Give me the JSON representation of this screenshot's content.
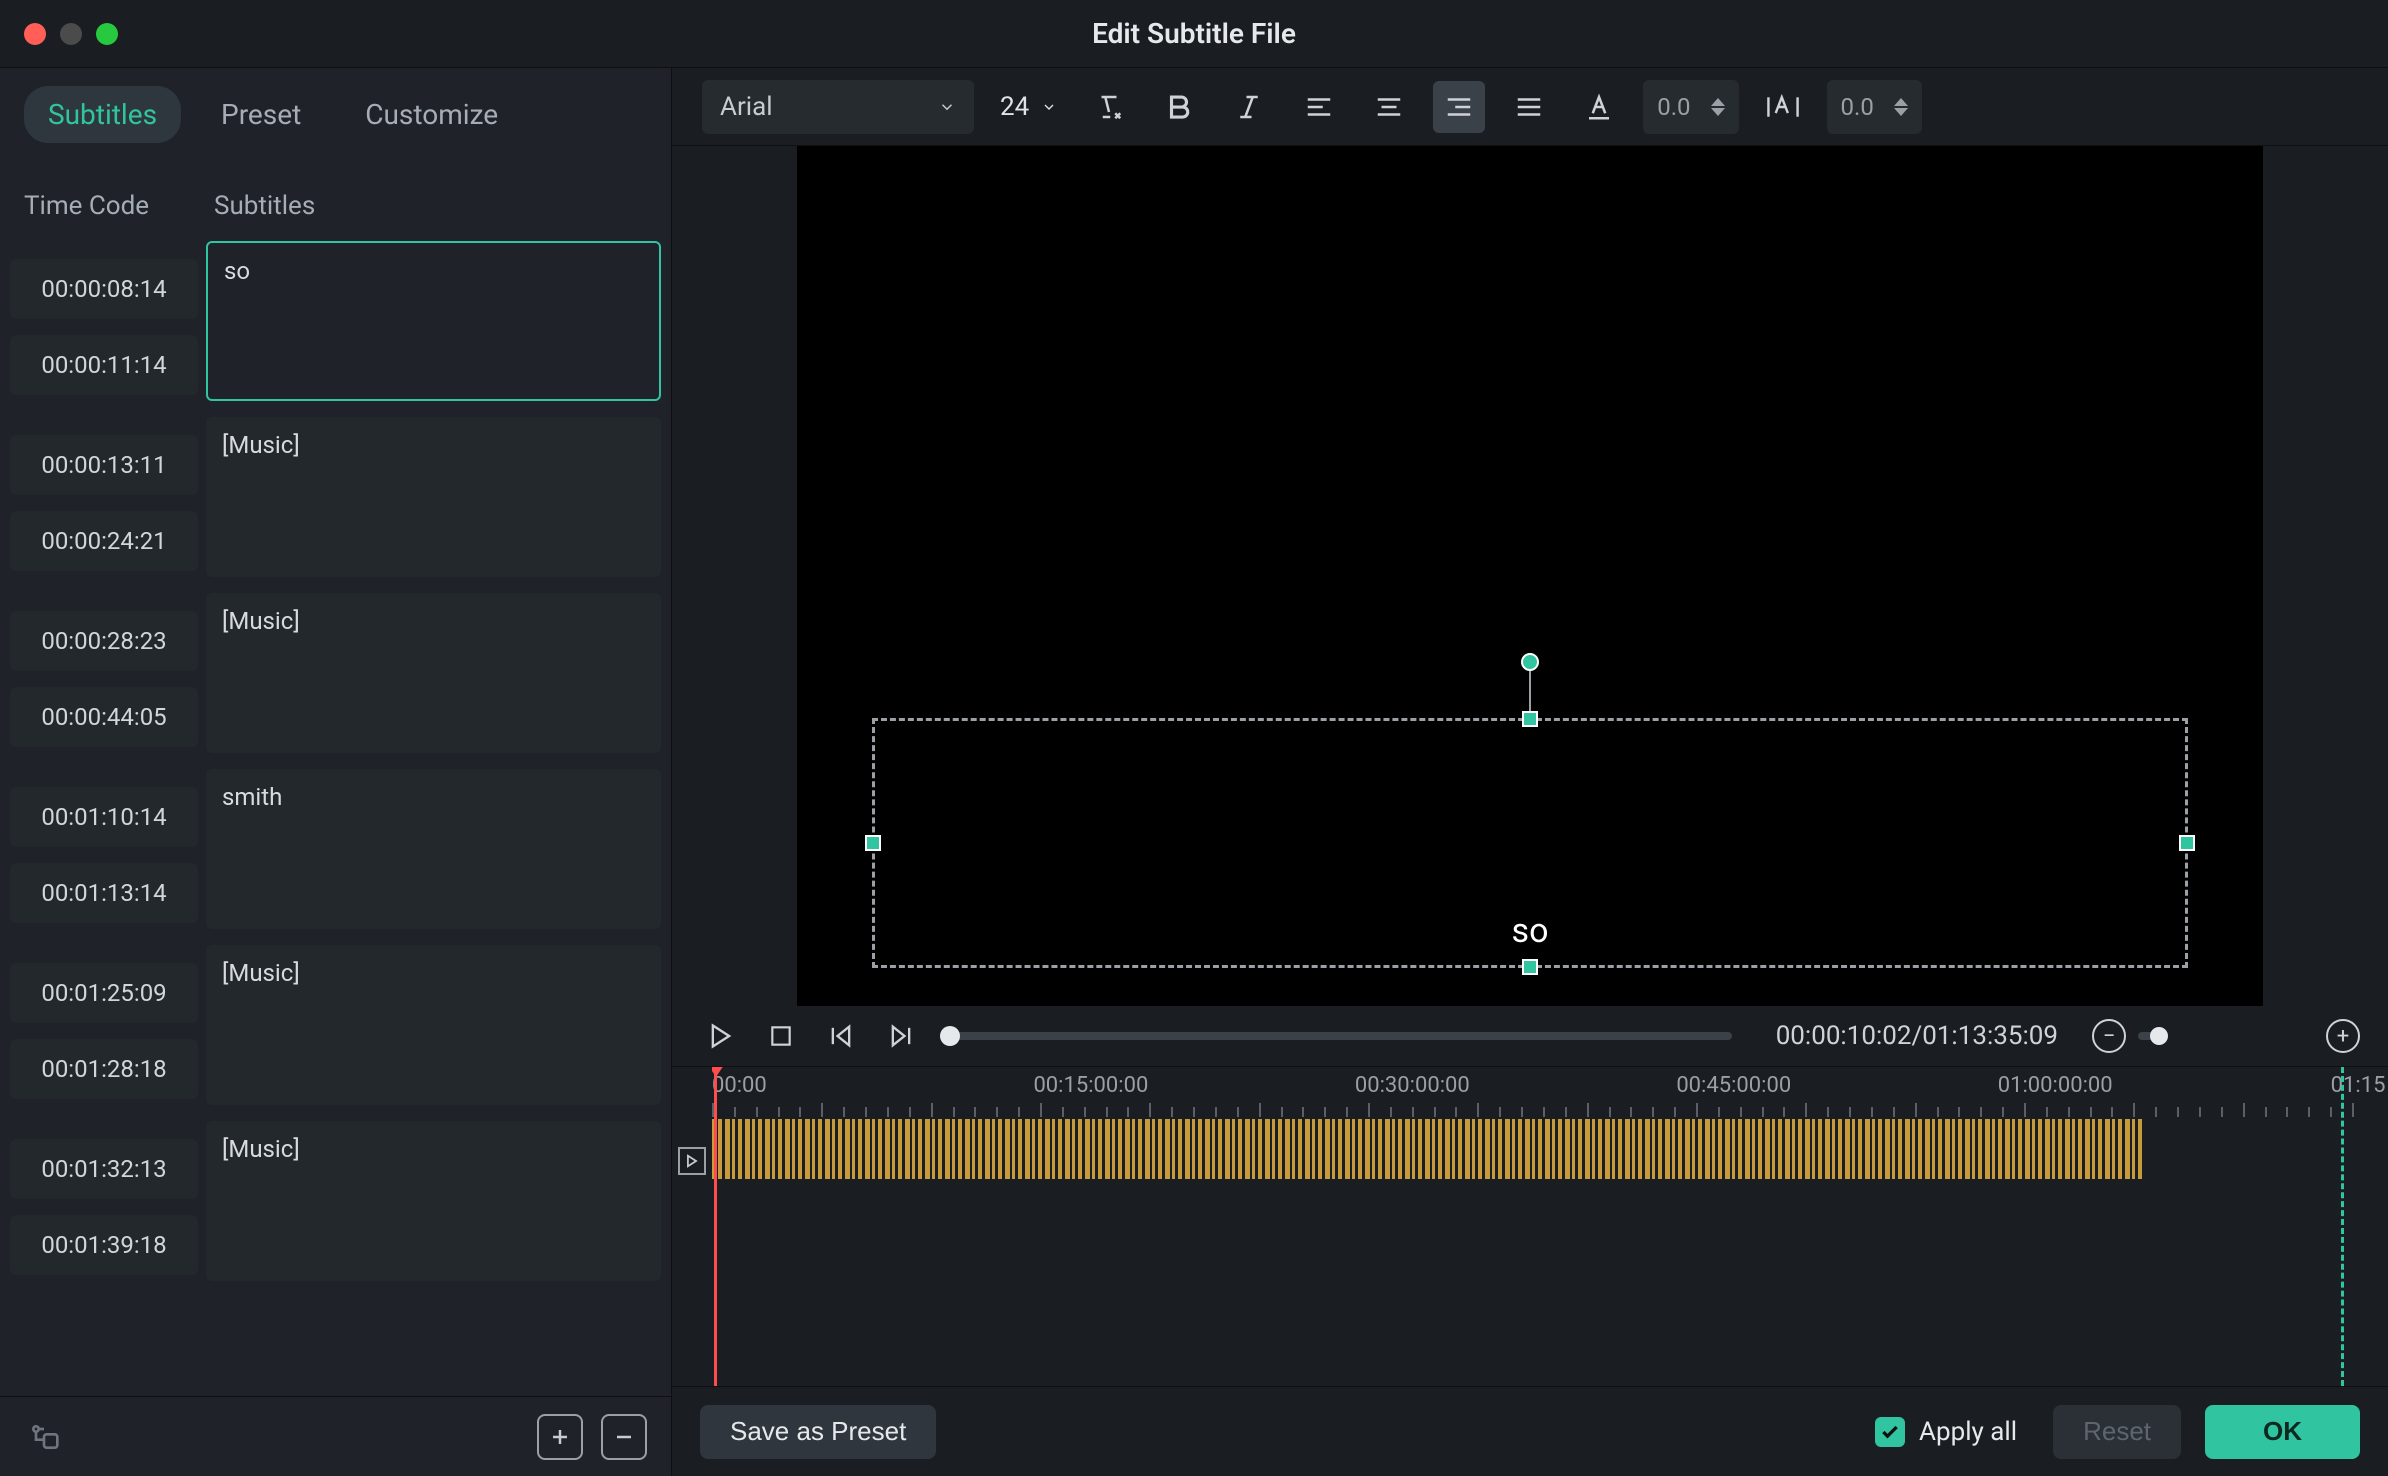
{
  "window": {
    "title": "Edit Subtitle File"
  },
  "tabs": {
    "subtitles": "Subtitles",
    "preset": "Preset",
    "customize": "Customize"
  },
  "headers": {
    "timecode": "Time Code",
    "subtitles": "Subtitles"
  },
  "rows": [
    {
      "start": "00:00:08:14",
      "end": "00:00:11:14",
      "text": "so",
      "active": true
    },
    {
      "start": "00:00:13:11",
      "end": "00:00:24:21",
      "text": "[Music]",
      "active": false
    },
    {
      "start": "00:00:28:23",
      "end": "00:00:44:05",
      "text": "[Music]",
      "active": false
    },
    {
      "start": "00:01:10:14",
      "end": "00:01:13:14",
      "text": "smith",
      "active": false
    },
    {
      "start": "00:01:25:09",
      "end": "00:01:28:18",
      "text": "[Music]",
      "active": false
    },
    {
      "start": "00:01:32:13",
      "end": "00:01:39:18",
      "text": "[Music]",
      "active": false
    }
  ],
  "toolbar": {
    "font": "Arial",
    "size": "24",
    "char_spacing": "0.0",
    "line_spacing": "0.0"
  },
  "preview": {
    "subtitle": "so"
  },
  "player": {
    "time": "00:00:10:02/01:13:35:09"
  },
  "timeline": {
    "labels": [
      "00:00",
      "00:15:00:00",
      "00:30:00:00",
      "00:45:00:00",
      "01:00:00:00",
      "01:15"
    ]
  },
  "bottom": {
    "save_preset": "Save as Preset",
    "apply_all": "Apply all",
    "reset": "Reset",
    "ok": "OK"
  }
}
